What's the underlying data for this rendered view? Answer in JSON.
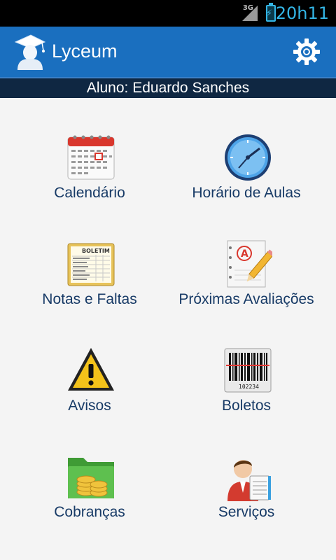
{
  "status_bar": {
    "network": "3G",
    "time": "20h11"
  },
  "app_bar": {
    "title": "Lyceum"
  },
  "student": {
    "text": "Aluno: Eduardo Sanches"
  },
  "menu": [
    {
      "label": "Calendário",
      "icon": "calendar-icon"
    },
    {
      "label": "Horário de Aulas",
      "icon": "clock-icon"
    },
    {
      "label": "Notas e Faltas",
      "icon": "report-card-icon"
    },
    {
      "label": "Próximas Avaliações",
      "icon": "exam-icon"
    },
    {
      "label": "Avisos",
      "icon": "warning-icon"
    },
    {
      "label": "Boletos",
      "icon": "barcode-icon"
    },
    {
      "label": "Cobranças",
      "icon": "folder-coins-icon"
    },
    {
      "label": "Serviços",
      "icon": "services-person-icon"
    }
  ],
  "icons": {
    "calendar_title": "",
    "report_title": "BOLETIM",
    "barcode_number": "102234"
  }
}
